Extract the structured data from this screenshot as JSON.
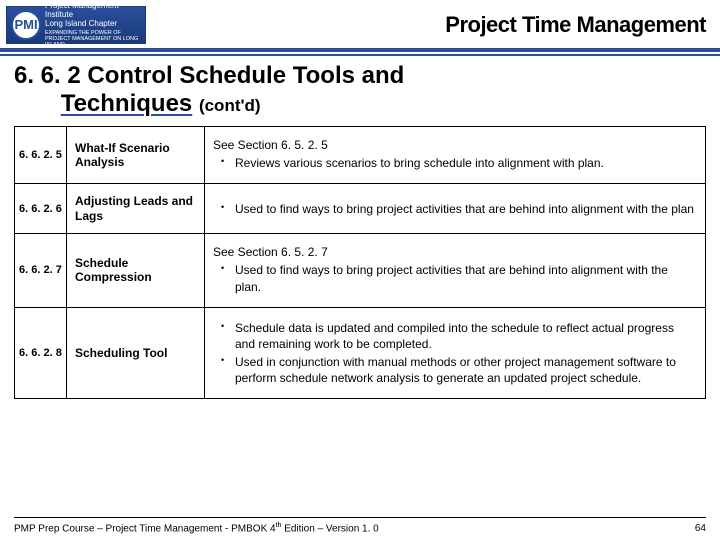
{
  "header": {
    "logo_name": "PMI",
    "logo_line1": "Project Management Institute",
    "logo_line2": "Long Island Chapter",
    "logo_tag": "EXPANDING THE POWER OF PROJECT MANAGEMENT ON LONG ISLAND",
    "title": "Project Time Management"
  },
  "section": {
    "number": "6. 6. 2",
    "title_main": "Control Schedule Tools and",
    "title_second": "Techniques",
    "suffix": "(cont'd)"
  },
  "rows": [
    {
      "num": "6. 6. 2. 5",
      "name": "What-If Scenario Analysis",
      "intro": "See Section 6. 5. 2. 5",
      "bullets": [
        "Reviews various scenarios to bring schedule into alignment with plan."
      ]
    },
    {
      "num": "6. 6. 2. 6",
      "name": "Adjusting Leads and Lags",
      "intro": "",
      "bullets": [
        "Used to find ways to bring project activities that are behind into alignment with the plan"
      ]
    },
    {
      "num": "6. 6. 2. 7",
      "name": "Schedule Compression",
      "intro": "See Section 6. 5. 2. 7",
      "bullets": [
        "Used to find ways to bring project activities that are behind into alignment with the plan."
      ]
    },
    {
      "num": "6. 6. 2. 8",
      "name": "Scheduling Tool",
      "intro": "",
      "bullets": [
        "Schedule data is updated and compiled into the schedule to reflect actual progress and remaining work to be completed.",
        "Used in conjunction with manual methods or other project management software to perform schedule network analysis to generate an updated project schedule."
      ]
    }
  ],
  "footer": {
    "left_pre": "PMP Prep Course – Project Time Management - PMBOK 4",
    "left_sup": "th",
    "left_post": " Edition – Version 1. 0",
    "page": "64"
  }
}
